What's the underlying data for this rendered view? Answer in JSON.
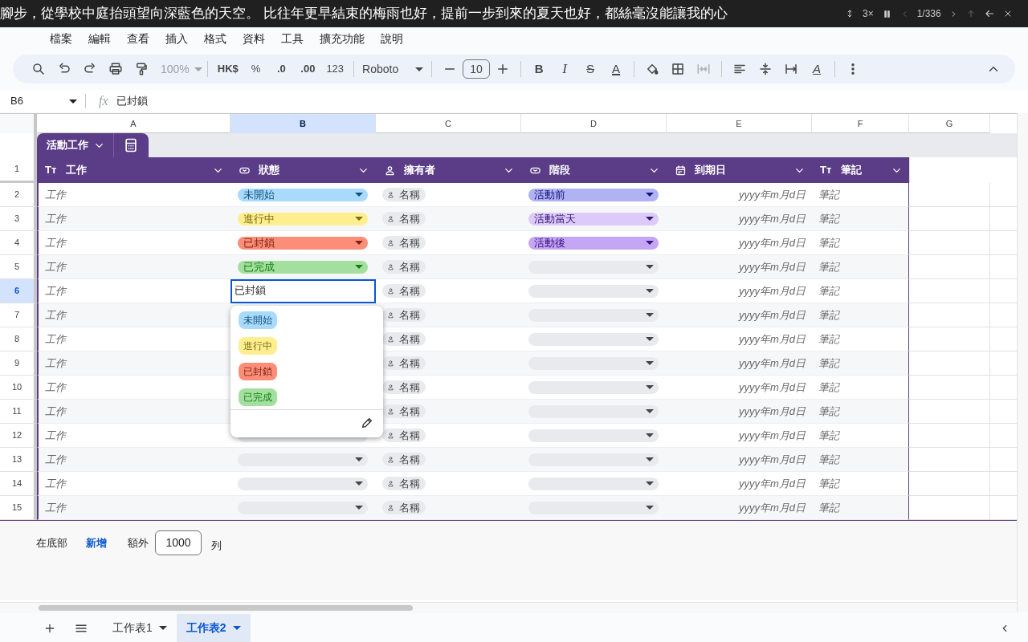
{
  "overlay": {
    "subtitle": "腳步，從學校中庭抬頭望向深藍色的天空。 比往年更早結束的梅雨也好，提前一步到來的夏天也好，都絲毫沒能讓我的心",
    "speed": "3×",
    "position": "1/336"
  },
  "menu": [
    "檔案",
    "編輯",
    "查看",
    "插入",
    "格式",
    "資料",
    "工具",
    "擴充功能",
    "說明"
  ],
  "toolbar": {
    "zoom": "100%",
    "currency": "HK$",
    "percent": "%",
    "decimal_decrease": ".0",
    "decimal_increase": ".00",
    "number_format": "123",
    "font": "Roboto",
    "font_size": "10",
    "bold": "B",
    "italic": "I",
    "strikethrough": "S",
    "text_color": "A",
    "rotation": "A"
  },
  "formula_bar": {
    "cell_ref": "B6",
    "fx": "fx",
    "value": "已封鎖"
  },
  "column_letters": [
    {
      "label": "A",
      "selected": false
    },
    {
      "label": "B",
      "selected": true
    },
    {
      "label": "C",
      "selected": false
    },
    {
      "label": "D",
      "selected": false
    },
    {
      "label": "E",
      "selected": false
    },
    {
      "label": "F",
      "selected": false
    },
    {
      "label": "G",
      "selected": false
    }
  ],
  "table": {
    "name": "活動工作",
    "columns": [
      {
        "label": "工作",
        "kind": "text",
        "icon_text": "Tт"
      },
      {
        "label": "狀態",
        "kind": "dropdown"
      },
      {
        "label": "擁有者",
        "kind": "person"
      },
      {
        "label": "階段",
        "kind": "dropdown"
      },
      {
        "label": "到期日",
        "kind": "date"
      },
      {
        "label": "筆記",
        "kind": "text",
        "icon_text": "Tт"
      }
    ],
    "header_row": "1",
    "rows": [
      {
        "number": "2",
        "selected": false,
        "task": "工作",
        "status": {
          "label": "未開始",
          "color": "#a8dafc"
        },
        "owner": "名稱",
        "stage": {
          "label": "活動前",
          "color": "#b0b2f4"
        },
        "due": "yyyy年m月d日",
        "note": "筆記"
      },
      {
        "number": "3",
        "selected": false,
        "task": "工作",
        "status": {
          "label": "進行中",
          "color": "#fdef8f"
        },
        "owner": "名稱",
        "stage": {
          "label": "活動當天",
          "color": "#dccbf8"
        },
        "due": "yyyy年m月d日",
        "note": "筆記"
      },
      {
        "number": "4",
        "selected": false,
        "task": "工作",
        "status": {
          "label": "已封鎖",
          "color": "#fc8d79"
        },
        "owner": "名稱",
        "stage": {
          "label": "活動後",
          "color": "#c4a6f5"
        },
        "due": "yyyy年m月d日",
        "note": "筆記"
      },
      {
        "number": "5",
        "selected": false,
        "task": "工作",
        "status": {
          "label": "已完成",
          "color": "#a3e0a0"
        },
        "owner": "名稱",
        "due": "yyyy年m月d日",
        "note": "筆記"
      },
      {
        "number": "6",
        "selected": true,
        "task": "工作",
        "status_input": "已封鎖",
        "owner": "名稱",
        "due": "yyyy年m月d日",
        "note": "筆記"
      },
      {
        "number": "7",
        "selected": false,
        "task": "工作",
        "owner": "名稱",
        "due": "yyyy年m月d日",
        "note": "筆記"
      },
      {
        "number": "8",
        "selected": false,
        "task": "工作",
        "owner": "名稱",
        "due": "yyyy年m月d日",
        "note": "筆記"
      },
      {
        "number": "9",
        "selected": false,
        "task": "工作",
        "owner": "名稱",
        "due": "yyyy年m月d日",
        "note": "筆記"
      },
      {
        "number": "10",
        "selected": false,
        "task": "工作",
        "owner": "名稱",
        "due": "yyyy年m月d日",
        "note": "筆記"
      },
      {
        "number": "11",
        "selected": false,
        "task": "工作",
        "owner": "名稱",
        "due": "yyyy年m月d日",
        "note": "筆記"
      },
      {
        "number": "12",
        "selected": false,
        "task": "工作",
        "owner": "名稱",
        "due": "yyyy年m月d日",
        "note": "筆記"
      },
      {
        "number": "13",
        "selected": false,
        "task": "工作",
        "owner": "名稱",
        "due": "yyyy年m月d日",
        "note": "筆記"
      },
      {
        "number": "14",
        "selected": false,
        "task": "工作",
        "owner": "名稱",
        "due": "yyyy年m月d日",
        "note": "筆記"
      },
      {
        "number": "15",
        "selected": false,
        "task": "工作",
        "owner": "名稱",
        "due": "yyyy年m月d日",
        "note": "筆記"
      }
    ]
  },
  "dropdown": {
    "options": [
      {
        "label": "未開始",
        "color": "#a8dafc"
      },
      {
        "label": "進行中",
        "color": "#fdef8f"
      },
      {
        "label": "已封鎖",
        "color": "#fc8d79"
      },
      {
        "label": "已完成",
        "color": "#a3e0a0"
      }
    ]
  },
  "footer": {
    "prefix": "在底部",
    "add_link": "新增",
    "extra": "額外",
    "count": "1000",
    "suffix": "列"
  },
  "sheet_tabs": [
    {
      "label": "工作表1",
      "selected": false
    },
    {
      "label": "工作表2",
      "selected": true
    }
  ]
}
